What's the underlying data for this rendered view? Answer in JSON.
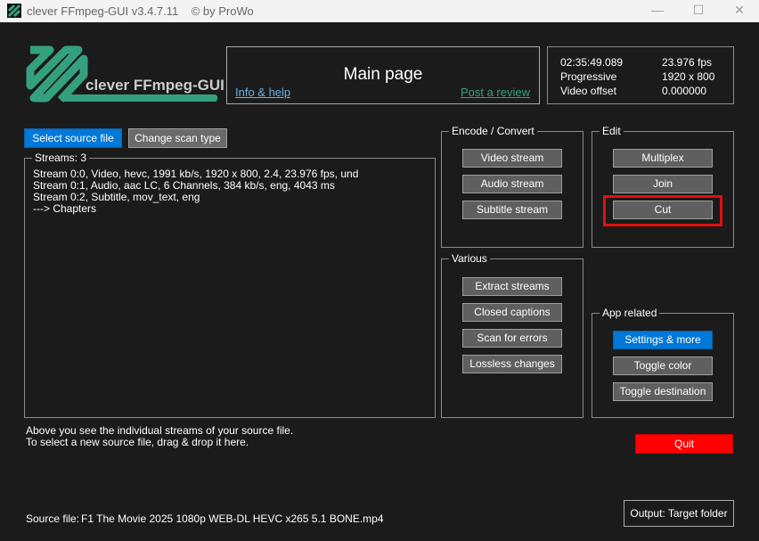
{
  "window": {
    "title": "clever FFmpeg-GUI v3.4.7.11    © by ProWo",
    "minimize": "—",
    "maximize": "☐",
    "close": "✕"
  },
  "logo": {
    "text": "clever FFmpeg-GUI"
  },
  "header": {
    "title": "Main page",
    "info_link": "Info & help",
    "review_link": "Post a review"
  },
  "info": {
    "duration": "02:35:49.089",
    "fps": "23.976 fps",
    "scan": "Progressive",
    "resolution": "1920 x 800",
    "offset_label": "Video offset",
    "offset_value": "0.000000"
  },
  "toolbar": {
    "select_source": "Select source file",
    "change_scan": "Change scan type"
  },
  "streams": {
    "legend": "Streams: 3",
    "lines": [
      "Stream 0:0, Video, hevc, 1991 kb/s, 1920 x 800, 2.4, 23.976 fps, und",
      "Stream 0:1, Audio, aac LC, 6 Channels, 384 kb/s, eng, 4043 ms",
      "Stream 0:2, Subtitle, mov_text, eng",
      "---> Chapters"
    ]
  },
  "encode": {
    "legend": "Encode / Convert",
    "buttons": [
      "Video stream",
      "Audio stream",
      "Subtitle stream"
    ]
  },
  "various": {
    "legend": "Various",
    "buttons": [
      "Extract streams",
      "Closed captions",
      "Scan for errors",
      "Lossless changes"
    ]
  },
  "edit": {
    "legend": "Edit",
    "buttons": [
      "Multiplex",
      "Join",
      "Cut"
    ]
  },
  "app": {
    "legend": "App related",
    "buttons": [
      "Settings & more",
      "Toggle color",
      "Toggle destination"
    ]
  },
  "hint": {
    "line1": "Above you see the individual streams of your source file.",
    "line2": "To select a new source file, drag & drop it here."
  },
  "quit": "Quit",
  "footer": {
    "source_label": "Source file:",
    "source_value": "F1 The Movie 2025 1080p WEB-DL HEVC x265 5.1 BONE.mp4",
    "output": "Output: Target folder"
  },
  "colors": {
    "accent": "#0078d7",
    "logo": "#35a07f",
    "quit": "#ff0000",
    "highlight": "#e01010"
  }
}
